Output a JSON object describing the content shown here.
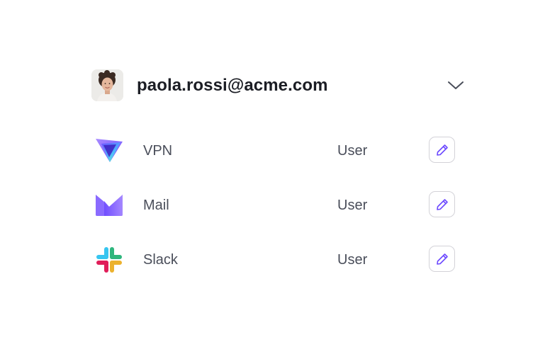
{
  "user": {
    "email": "paola.rossi@acme.com",
    "avatar_icon": "avatar-photo",
    "expand_icon": "chevron-down-icon"
  },
  "apps": [
    {
      "name": "VPN",
      "role": "User",
      "icon": "vpn-logo-icon",
      "edit_icon": "pencil-icon"
    },
    {
      "name": "Mail",
      "role": "User",
      "icon": "mail-logo-icon",
      "edit_icon": "pencil-icon"
    },
    {
      "name": "Slack",
      "role": "User",
      "icon": "slack-logo-icon",
      "edit_icon": "pencil-icon"
    }
  ],
  "colors": {
    "accent": "#6d4aff",
    "text_primary": "#1b1d24",
    "text_secondary": "#4a4e5a",
    "border": "#d3d2d8"
  }
}
